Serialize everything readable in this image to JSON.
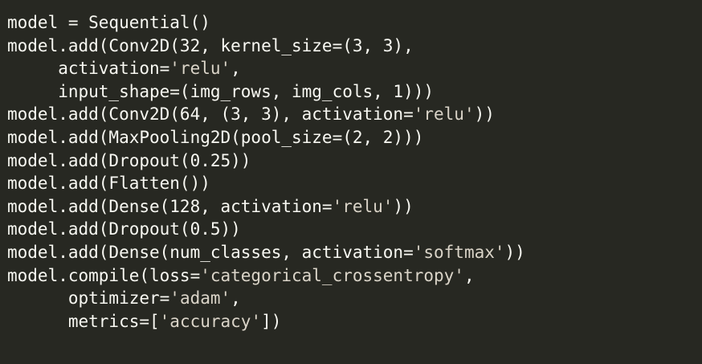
{
  "editor": {
    "language": "python",
    "colors": {
      "background": "#272822",
      "text": "#f8f8f2",
      "string": "#d9c9a8"
    },
    "lines": [
      {
        "tokens": [
          {
            "t": "plain",
            "v": "model = Sequential()"
          }
        ]
      },
      {
        "tokens": [
          {
            "t": "plain",
            "v": "model.add(Conv2D(32, kernel_size=(3, 3),"
          }
        ]
      },
      {
        "tokens": [
          {
            "t": "plain",
            "v": "     activation="
          },
          {
            "t": "str",
            "v": "'relu'"
          },
          {
            "t": "plain",
            "v": ","
          }
        ]
      },
      {
        "tokens": [
          {
            "t": "plain",
            "v": "     input_shape=(img_rows, img_cols, 1)))"
          }
        ]
      },
      {
        "tokens": [
          {
            "t": "plain",
            "v": "model.add(Conv2D(64, (3, 3), activation="
          },
          {
            "t": "str",
            "v": "'relu'"
          },
          {
            "t": "plain",
            "v": "))"
          }
        ]
      },
      {
        "tokens": [
          {
            "t": "plain",
            "v": "model.add(MaxPooling2D(pool_size=(2, 2)))"
          }
        ]
      },
      {
        "tokens": [
          {
            "t": "plain",
            "v": "model.add(Dropout(0.25))"
          }
        ]
      },
      {
        "tokens": [
          {
            "t": "plain",
            "v": "model.add(Flatten())"
          }
        ]
      },
      {
        "tokens": [
          {
            "t": "plain",
            "v": "model.add(Dense(128, activation="
          },
          {
            "t": "str",
            "v": "'relu'"
          },
          {
            "t": "plain",
            "v": "))"
          }
        ]
      },
      {
        "tokens": [
          {
            "t": "plain",
            "v": "model.add(Dropout(0.5))"
          }
        ]
      },
      {
        "tokens": [
          {
            "t": "plain",
            "v": "model.add(Dense(num_classes, activation="
          },
          {
            "t": "str",
            "v": "'softmax'"
          },
          {
            "t": "plain",
            "v": "))"
          }
        ]
      },
      {
        "tokens": [
          {
            "t": "plain",
            "v": "model.compile(loss="
          },
          {
            "t": "str",
            "v": "'categorical_crossentropy'"
          },
          {
            "t": "plain",
            "v": ","
          }
        ]
      },
      {
        "tokens": [
          {
            "t": "plain",
            "v": "      optimizer="
          },
          {
            "t": "str",
            "v": "'adam'"
          },
          {
            "t": "plain",
            "v": ","
          }
        ]
      },
      {
        "tokens": [
          {
            "t": "plain",
            "v": "      metrics=["
          },
          {
            "t": "str",
            "v": "'accuracy'"
          },
          {
            "t": "plain",
            "v": "])"
          }
        ]
      }
    ]
  }
}
